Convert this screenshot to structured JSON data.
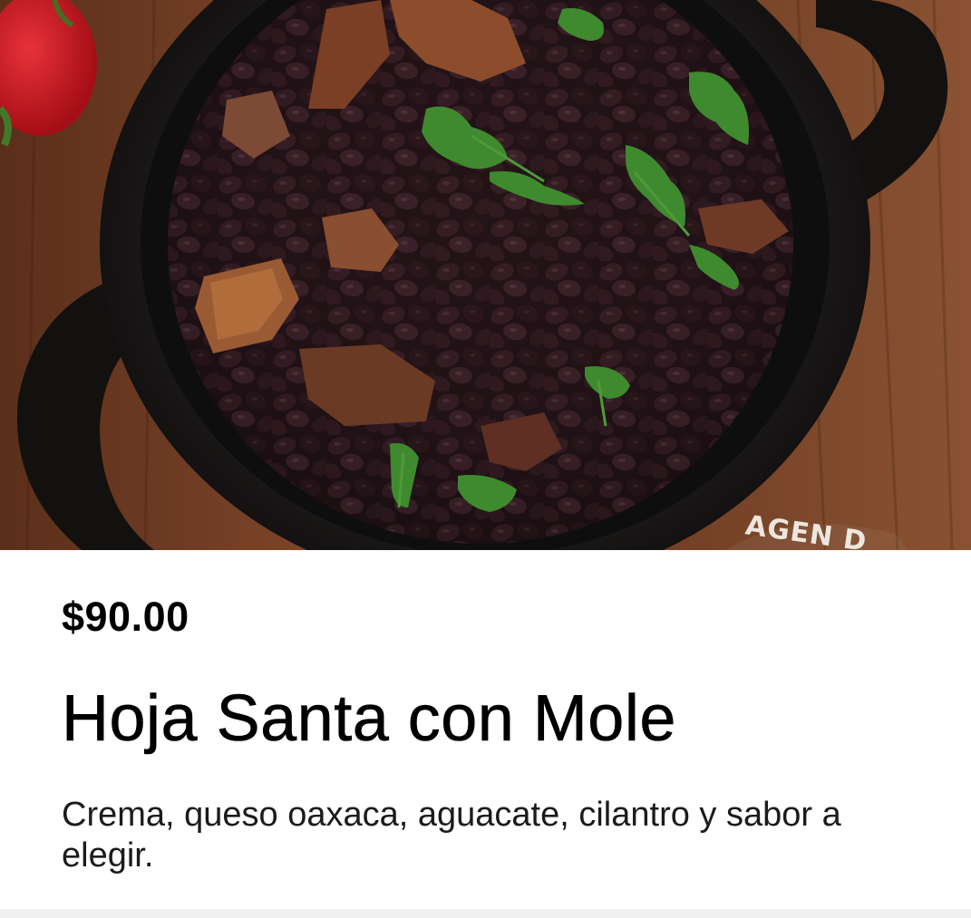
{
  "product": {
    "image_alt": "Hoja Santa con Mole",
    "image_watermark": "AGEN D",
    "price": "$90.00",
    "name": "Hoja Santa con Mole",
    "description": "Crema, queso oaxaca, aguacate, cilantro y sabor a elegir."
  },
  "colors": {
    "wood": "#6b3a22",
    "pot": "#151312",
    "beans": "#2a171b",
    "cilantro": "#3f8a2e",
    "pepper": "#c8141c",
    "text": "#000000",
    "background": "#ffffff"
  }
}
